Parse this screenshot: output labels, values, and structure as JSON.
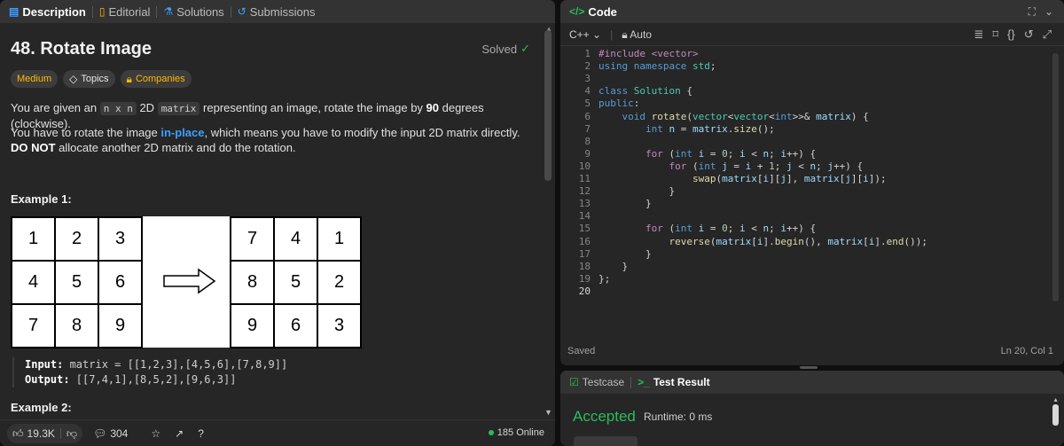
{
  "left_tabs": [
    {
      "label": "Description",
      "icon": "document-icon"
    },
    {
      "label": "Editorial",
      "icon": "book-icon"
    },
    {
      "label": "Solutions",
      "icon": "flask-icon"
    },
    {
      "label": "Submissions",
      "icon": "history-icon"
    }
  ],
  "problem": {
    "title": "48. Rotate Image",
    "solved_label": "Solved",
    "difficulty": "Medium",
    "topics_label": "Topics",
    "companies_label": "Companies",
    "para1": {
      "t1": "You are given an ",
      "code1": "n x n",
      "t2": " 2D ",
      "code2": "matrix",
      "t3": " representing an image, rotate the image by ",
      "bold1": "90",
      "t4": " degrees (clockwise)."
    },
    "para2": {
      "t1": "You have to rotate the image ",
      "link": "in-place",
      "t2": ", which means you have to modify the input 2D matrix directly. ",
      "bold1": "DO NOT",
      "t3": " allocate another 2D matrix and do the rotation."
    },
    "example1_title": "Example 1:",
    "example2_title": "Example 2:",
    "matrix_before": [
      "1",
      "2",
      "3",
      "4",
      "5",
      "6",
      "7",
      "8",
      "9"
    ],
    "matrix_after": [
      "7",
      "4",
      "1",
      "8",
      "5",
      "2",
      "9",
      "6",
      "3"
    ],
    "input_label": "Input:",
    "input_value": " matrix = [[1,2,3],[4,5,6],[7,8,9]]",
    "output_label": "Output:",
    "output_value": " [[7,4,1],[8,5,2],[9,6,3]]"
  },
  "bottom_bar": {
    "likes": "19.3K",
    "comments": "304",
    "online": "185 Online"
  },
  "code_panel": {
    "title": "Code",
    "language": "C++",
    "mode": "Auto",
    "status": "Saved",
    "cursor": "Ln 20, Col 1"
  },
  "code_lines": [
    "#include <vector>",
    "using namespace std;",
    "",
    "class Solution {",
    "public:",
    "    void rotate(vector<vector<int>>& matrix) {",
    "        int n = matrix.size();",
    "",
    "        for (int i = 0; i < n; i++) {",
    "            for (int j = i + 1; j < n; j++) {",
    "                swap(matrix[i][j], matrix[j][i]);",
    "            }",
    "        }",
    "",
    "        for (int i = 0; i < n; i++) {",
    "            reverse(matrix[i].begin(), matrix[i].end());",
    "        }",
    "    }",
    "};",
    ""
  ],
  "result_panel": {
    "testcase_label": "Testcase",
    "test_result_label": "Test Result",
    "verdict": "Accepted",
    "runtime": "Runtime: 0 ms"
  },
  "colors": {
    "accepted": "#2cbb5d",
    "medium": "#ffb800",
    "link": "#3b9eff",
    "background": "#262626"
  }
}
